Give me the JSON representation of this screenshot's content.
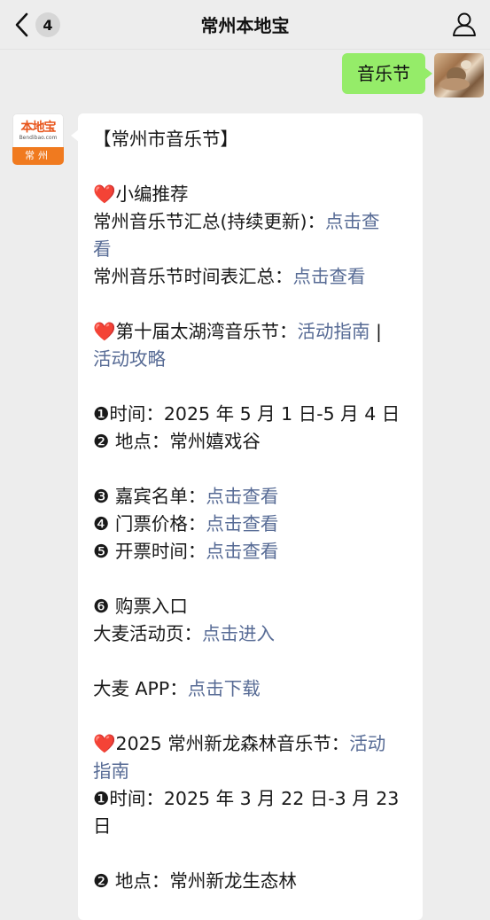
{
  "header": {
    "back_count": "4",
    "title": "常州本地宝"
  },
  "outgoing": {
    "message": "音乐节"
  },
  "bot": {
    "logo_main": "本地宝",
    "logo_sub": "Bendibao.com",
    "logo_city": "常州"
  },
  "article": {
    "heading": "【常州市音乐节】",
    "rec_heart": "❤️",
    "rec_title": "小编推荐",
    "rec1_label": "常州音乐节汇总(持续更新)：",
    "rec1_link_a": "点击查",
    "rec1_link_b": "看",
    "rec2_label": "常州音乐节时间表汇总：",
    "rec2_link": "点击查看",
    "fest1_heart": "❤️",
    "fest1_title": "第十届太湖湾音乐节：",
    "fest1_link1": "活动指南",
    "fest1_sep": " |",
    "fest1_link2": "活动攻略",
    "f1_time": "❶时间：2025 年 5 月 1 日-5 月 4 日",
    "f1_place": "❷ 地点：常州嬉戏谷",
    "f1_guest_label": "❸ 嘉宾名单：",
    "f1_guest_link": "点击查看",
    "f1_price_label": "❹ 门票价格：",
    "f1_price_link": "点击查看",
    "f1_sale_label": "❺ 开票时间：",
    "f1_sale_link": "点击查看",
    "f1_buy": "❻ 购票入口",
    "f1_damai_label": "大麦活动页：",
    "f1_damai_link": "点击进入",
    "f1_app_label": "大麦 APP：",
    "f1_app_link": "点击下载",
    "fest2_heart": "❤️",
    "fest2_title": "2025 常州新龙森林音乐节：",
    "fest2_link_a": "活动",
    "fest2_link_b": "指南",
    "f2_time_a": "❶时间：2025 年 3 月 22 日-3 月 23",
    "f2_time_b": "日",
    "f2_place": "❷ 地点：常州新龙生态林"
  },
  "colors": {
    "background": "#ededed",
    "outgoing_bubble": "#95ec69",
    "link": "#576b95",
    "heart": "#e0322e",
    "logo_orange": "#f07a1f"
  },
  "icons": [
    "back-chevron-icon",
    "person-icon"
  ]
}
